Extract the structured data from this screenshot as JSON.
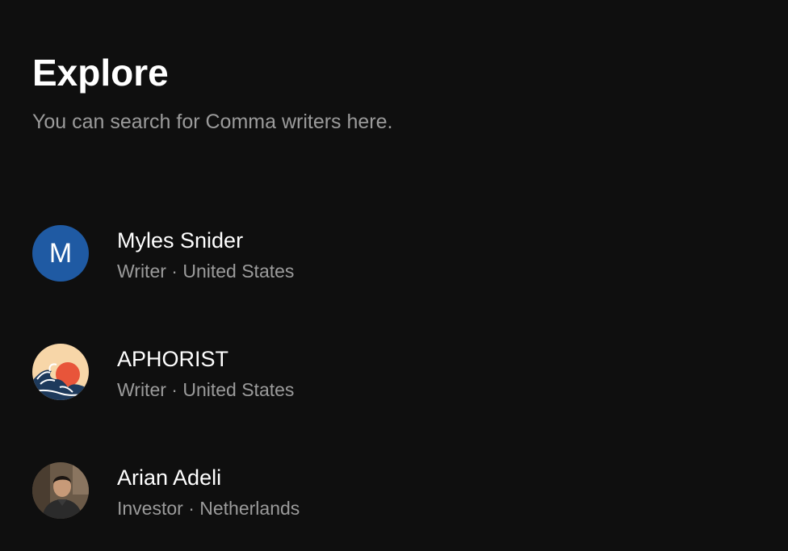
{
  "header": {
    "title": "Explore",
    "subtitle": "You can search for Comma writers here."
  },
  "writers": [
    {
      "name": "Myles Snider",
      "role": "Writer",
      "location": "United States",
      "meta": "Writer · United States",
      "avatar": {
        "type": "letter",
        "letter": "M",
        "color": "#1f5aa3"
      }
    },
    {
      "name": "APHORIST",
      "role": "Writer",
      "location": "United States",
      "meta": "Writer · United States",
      "avatar": {
        "type": "image",
        "icon": "great-wave-sun-icon",
        "colors": [
          "#f7d6a8",
          "#e8553a",
          "#1e3a5c"
        ]
      }
    },
    {
      "name": "Arian Adeli",
      "role": "Investor",
      "location": "Netherlands",
      "meta": "Investor · Netherlands",
      "avatar": {
        "type": "image",
        "icon": "profile-photo-icon",
        "colors": [
          "#5a4a3a",
          "#2a2a2a"
        ]
      }
    }
  ],
  "colors": {
    "background": "#0f0f0f",
    "text_primary": "#ffffff",
    "text_secondary": "#9b9b9b"
  }
}
